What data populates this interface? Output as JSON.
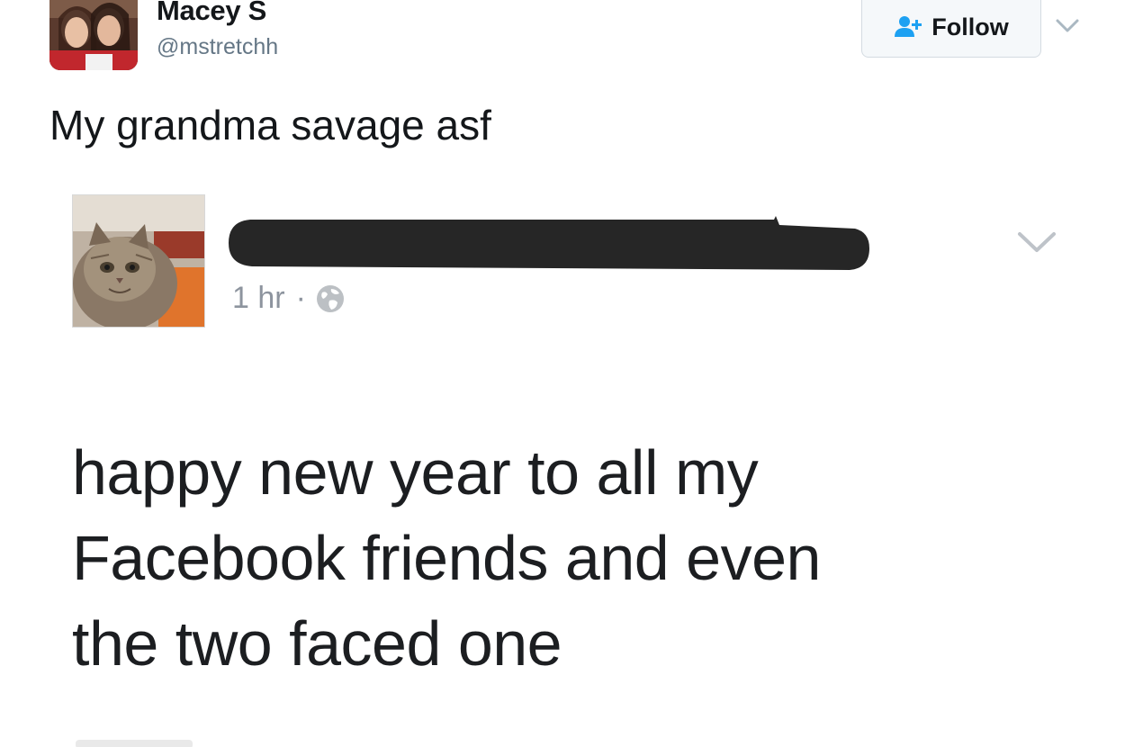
{
  "tweet": {
    "author": {
      "display_name": "Macey S",
      "handle": "@mstretchh"
    },
    "follow_button": {
      "label": "Follow",
      "icon": "add-user-icon"
    },
    "menu_icon": "chevron-down-icon",
    "text": "My grandma savage asf"
  },
  "embedded_post": {
    "author_name_redacted": true,
    "avatar_subject": "cat",
    "timestamp": "1 hr",
    "separator": "·",
    "audience_icon": "globe-icon",
    "menu_icon": "chevron-down-icon",
    "body_lines": [
      "happy new year to all my",
      "Facebook friends and even",
      "the two faced one"
    ]
  },
  "colors": {
    "tweet_text": "#14171a",
    "secondary_text": "#657786",
    "follow_icon": "#1da1f2",
    "fb_meta": "#8d949e",
    "redaction": "#262626"
  }
}
